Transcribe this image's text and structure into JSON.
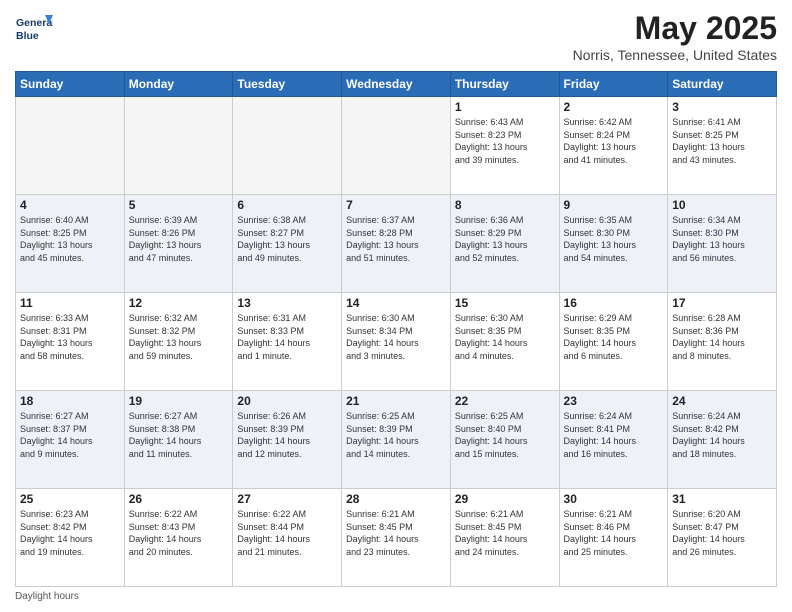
{
  "header": {
    "logo_line1": "General",
    "logo_line2": "Blue",
    "month_title": "May 2025",
    "location": "Norris, Tennessee, United States"
  },
  "days_of_week": [
    "Sunday",
    "Monday",
    "Tuesday",
    "Wednesday",
    "Thursday",
    "Friday",
    "Saturday"
  ],
  "weeks": [
    [
      {
        "day": "",
        "info": ""
      },
      {
        "day": "",
        "info": ""
      },
      {
        "day": "",
        "info": ""
      },
      {
        "day": "",
        "info": ""
      },
      {
        "day": "1",
        "info": "Sunrise: 6:43 AM\nSunset: 8:23 PM\nDaylight: 13 hours\nand 39 minutes."
      },
      {
        "day": "2",
        "info": "Sunrise: 6:42 AM\nSunset: 8:24 PM\nDaylight: 13 hours\nand 41 minutes."
      },
      {
        "day": "3",
        "info": "Sunrise: 6:41 AM\nSunset: 8:25 PM\nDaylight: 13 hours\nand 43 minutes."
      }
    ],
    [
      {
        "day": "4",
        "info": "Sunrise: 6:40 AM\nSunset: 8:25 PM\nDaylight: 13 hours\nand 45 minutes."
      },
      {
        "day": "5",
        "info": "Sunrise: 6:39 AM\nSunset: 8:26 PM\nDaylight: 13 hours\nand 47 minutes."
      },
      {
        "day": "6",
        "info": "Sunrise: 6:38 AM\nSunset: 8:27 PM\nDaylight: 13 hours\nand 49 minutes."
      },
      {
        "day": "7",
        "info": "Sunrise: 6:37 AM\nSunset: 8:28 PM\nDaylight: 13 hours\nand 51 minutes."
      },
      {
        "day": "8",
        "info": "Sunrise: 6:36 AM\nSunset: 8:29 PM\nDaylight: 13 hours\nand 52 minutes."
      },
      {
        "day": "9",
        "info": "Sunrise: 6:35 AM\nSunset: 8:30 PM\nDaylight: 13 hours\nand 54 minutes."
      },
      {
        "day": "10",
        "info": "Sunrise: 6:34 AM\nSunset: 8:30 PM\nDaylight: 13 hours\nand 56 minutes."
      }
    ],
    [
      {
        "day": "11",
        "info": "Sunrise: 6:33 AM\nSunset: 8:31 PM\nDaylight: 13 hours\nand 58 minutes."
      },
      {
        "day": "12",
        "info": "Sunrise: 6:32 AM\nSunset: 8:32 PM\nDaylight: 13 hours\nand 59 minutes."
      },
      {
        "day": "13",
        "info": "Sunrise: 6:31 AM\nSunset: 8:33 PM\nDaylight: 14 hours\nand 1 minute."
      },
      {
        "day": "14",
        "info": "Sunrise: 6:30 AM\nSunset: 8:34 PM\nDaylight: 14 hours\nand 3 minutes."
      },
      {
        "day": "15",
        "info": "Sunrise: 6:30 AM\nSunset: 8:35 PM\nDaylight: 14 hours\nand 4 minutes."
      },
      {
        "day": "16",
        "info": "Sunrise: 6:29 AM\nSunset: 8:35 PM\nDaylight: 14 hours\nand 6 minutes."
      },
      {
        "day": "17",
        "info": "Sunrise: 6:28 AM\nSunset: 8:36 PM\nDaylight: 14 hours\nand 8 minutes."
      }
    ],
    [
      {
        "day": "18",
        "info": "Sunrise: 6:27 AM\nSunset: 8:37 PM\nDaylight: 14 hours\nand 9 minutes."
      },
      {
        "day": "19",
        "info": "Sunrise: 6:27 AM\nSunset: 8:38 PM\nDaylight: 14 hours\nand 11 minutes."
      },
      {
        "day": "20",
        "info": "Sunrise: 6:26 AM\nSunset: 8:39 PM\nDaylight: 14 hours\nand 12 minutes."
      },
      {
        "day": "21",
        "info": "Sunrise: 6:25 AM\nSunset: 8:39 PM\nDaylight: 14 hours\nand 14 minutes."
      },
      {
        "day": "22",
        "info": "Sunrise: 6:25 AM\nSunset: 8:40 PM\nDaylight: 14 hours\nand 15 minutes."
      },
      {
        "day": "23",
        "info": "Sunrise: 6:24 AM\nSunset: 8:41 PM\nDaylight: 14 hours\nand 16 minutes."
      },
      {
        "day": "24",
        "info": "Sunrise: 6:24 AM\nSunset: 8:42 PM\nDaylight: 14 hours\nand 18 minutes."
      }
    ],
    [
      {
        "day": "25",
        "info": "Sunrise: 6:23 AM\nSunset: 8:42 PM\nDaylight: 14 hours\nand 19 minutes."
      },
      {
        "day": "26",
        "info": "Sunrise: 6:22 AM\nSunset: 8:43 PM\nDaylight: 14 hours\nand 20 minutes."
      },
      {
        "day": "27",
        "info": "Sunrise: 6:22 AM\nSunset: 8:44 PM\nDaylight: 14 hours\nand 21 minutes."
      },
      {
        "day": "28",
        "info": "Sunrise: 6:21 AM\nSunset: 8:45 PM\nDaylight: 14 hours\nand 23 minutes."
      },
      {
        "day": "29",
        "info": "Sunrise: 6:21 AM\nSunset: 8:45 PM\nDaylight: 14 hours\nand 24 minutes."
      },
      {
        "day": "30",
        "info": "Sunrise: 6:21 AM\nSunset: 8:46 PM\nDaylight: 14 hours\nand 25 minutes."
      },
      {
        "day": "31",
        "info": "Sunrise: 6:20 AM\nSunset: 8:47 PM\nDaylight: 14 hours\nand 26 minutes."
      }
    ]
  ],
  "footer": {
    "daylight_hours_label": "Daylight hours"
  }
}
